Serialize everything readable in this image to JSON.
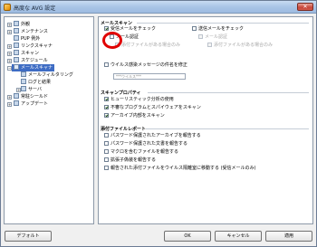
{
  "window": {
    "title": "高度な AVG 設定"
  },
  "tree": {
    "items": [
      {
        "label": "外観"
      },
      {
        "label": "メンテナンス"
      },
      {
        "label": "PUP 例外"
      },
      {
        "label": "リンクスキャナ"
      },
      {
        "label": "スキャン"
      },
      {
        "label": "スケジュール"
      },
      {
        "label": "メールスキャナ"
      },
      {
        "label": "メールフィルタリング"
      },
      {
        "label": "ログと結果"
      },
      {
        "label": "サーバ"
      },
      {
        "label": "常駐シールド"
      },
      {
        "label": "アップデート"
      }
    ]
  },
  "mail_scan": {
    "title": "メールスキャン",
    "check_incoming": "受信メールをチェック",
    "check_outgoing": "送信メールをチェック",
    "mail_certify_in": "メール認証",
    "attach_only_in": "添付ファイルがある場合のみ",
    "mail_certify_out": "メール認証",
    "attach_only_out": "添付ファイルがある場合のみ",
    "modify_subject": "ウイルス感染メッセージの件名を修正",
    "subject_value": "***ウイルス***"
  },
  "scan_props": {
    "title": "スキャンプロパティ",
    "heuristics": "ヒューリスティック分析の使用",
    "pup": "不審なプログラムとスパイウェアをスキャン",
    "archives": "アーカイブ内部をスキャン"
  },
  "attachment_report": {
    "title": "添付ファイルレポート",
    "items": [
      "パスワード保護されたアーカイブを報告する",
      "パスワード保護された文書を報告する",
      "マクロを含むファイルを報告する",
      "拡張子偽装を報告する",
      "報告された添付ファイルをウイルス隔離室に移動する (受信メールのみ)"
    ]
  },
  "buttons": {
    "default": "デフォルト",
    "ok": "OK",
    "cancel": "キャンセル",
    "apply": "適用"
  }
}
